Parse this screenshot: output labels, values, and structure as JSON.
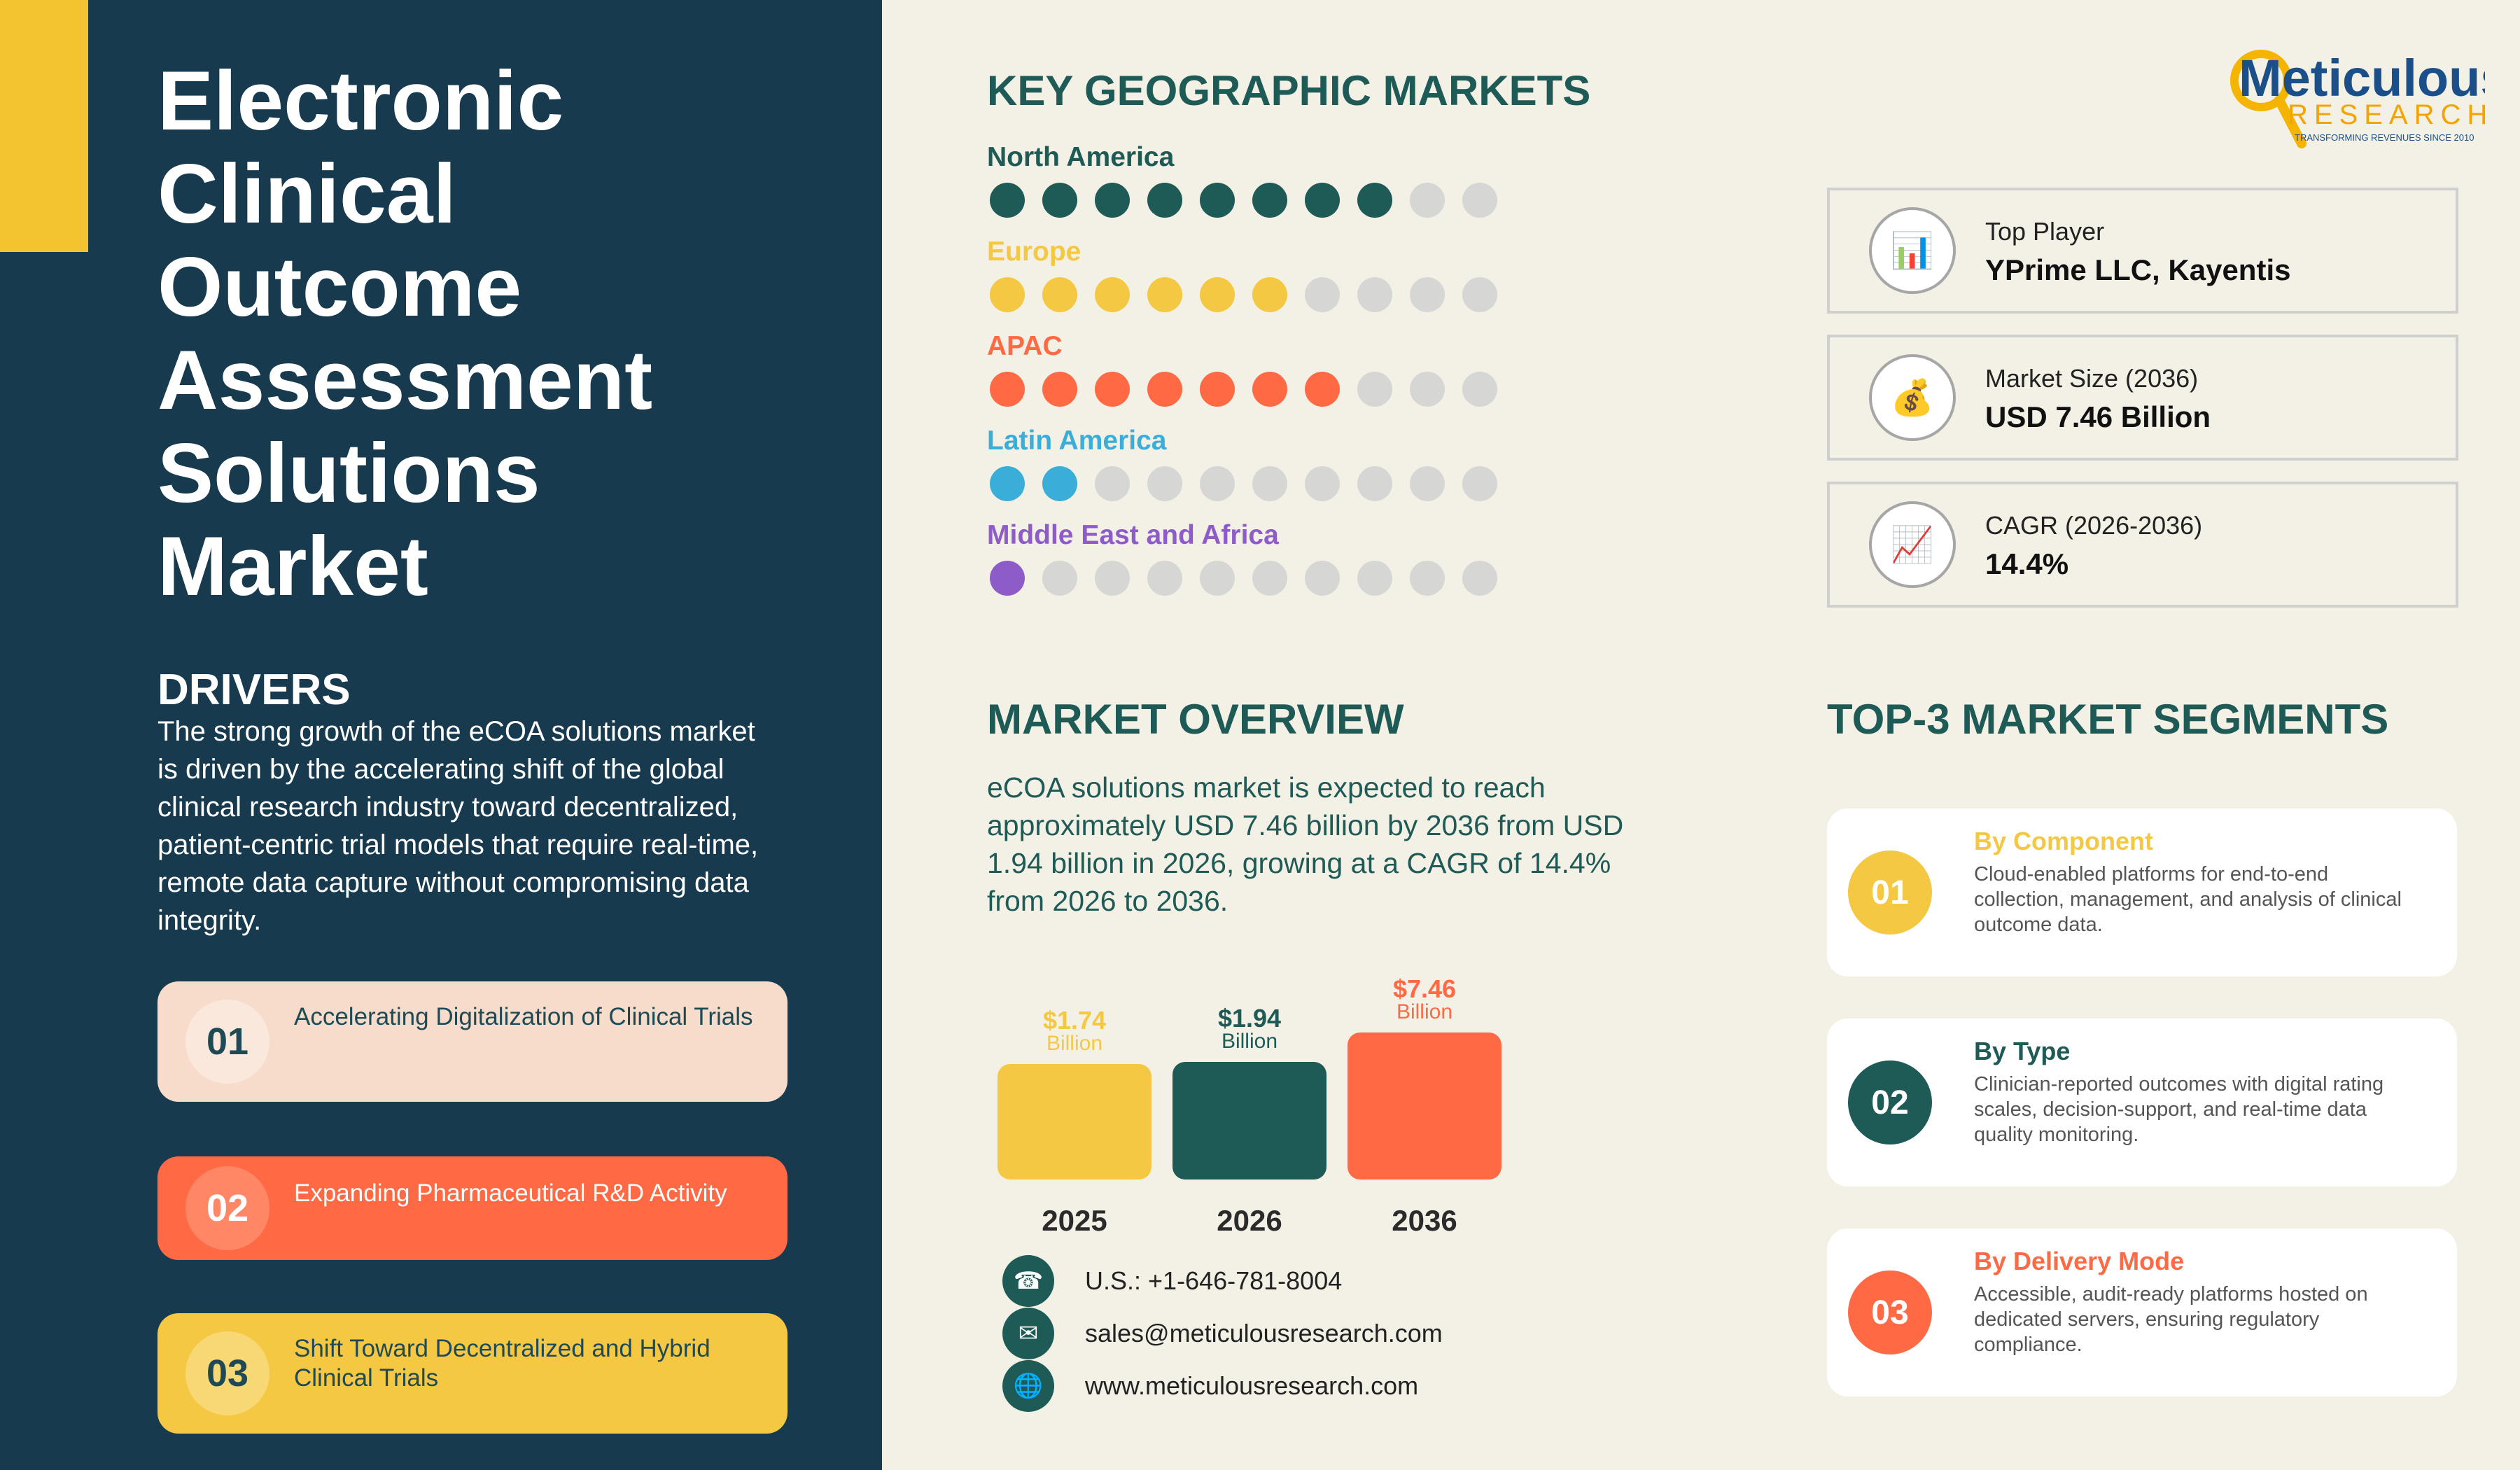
{
  "title_lines": [
    "Electronic",
    "Clinical",
    "Outcome",
    "Assessment",
    "Solutions",
    "Market"
  ],
  "drivers": {
    "heading": "DRIVERS",
    "text": "The strong growth of the eCOA solutions market is driven by the accelerating shift of the global clinical research industry toward decentralized, patient-centric trial models that require real-time, remote data capture without compromising data integrity.",
    "items": [
      {
        "num": "01",
        "label": "Accelerating Digitalization of Clinical Trials"
      },
      {
        "num": "02",
        "label": "Expanding Pharmaceutical R&D Activity"
      },
      {
        "num": "03",
        "label": "Shift Toward Decentralized and Hybrid Clinical Trials"
      }
    ]
  },
  "geo": {
    "heading": "KEY GEOGRAPHIC MARKETS",
    "regions": [
      {
        "name": "North America",
        "filled": 8,
        "total": 10,
        "color": "#1e5a56"
      },
      {
        "name": "Europe",
        "filled": 6,
        "total": 10,
        "color": "#f4c843"
      },
      {
        "name": "APAC",
        "filled": 7,
        "total": 10,
        "color": "#ff6a45"
      },
      {
        "name": "Latin America",
        "filled": 2,
        "total": 10,
        "color": "#3aaed8"
      },
      {
        "name": "Middle East and Africa",
        "filled": 1,
        "total": 10,
        "color": "#8e5cc9"
      }
    ]
  },
  "overview": {
    "heading": "MARKET OVERVIEW",
    "text": "eCOA solutions market is expected to reach approximately USD 7.46 billion by 2036 from USD 1.94 billion in 2026, growing at a CAGR of 14.4% from 2026 to 2036."
  },
  "chart_data": {
    "type": "bar",
    "categories": [
      "2025",
      "2026",
      "2036"
    ],
    "values": [
      1.74,
      1.94,
      7.46
    ],
    "value_labels": [
      "$1.74",
      "$1.94",
      "$7.46"
    ],
    "unit_label": "Billion",
    "colors": [
      "#f4c843",
      "#1e5a56",
      "#ff6a45"
    ],
    "label_colors": [
      "#f4c843",
      "#1e5a56",
      "#ff6a45"
    ]
  },
  "contacts": [
    {
      "icon": "phone-icon",
      "glyph": "☎",
      "text": "U.S.: +1-646-781-8004"
    },
    {
      "icon": "email-icon",
      "glyph": "✉",
      "text": "sales@meticulousresearch.com"
    },
    {
      "icon": "globe-icon",
      "glyph": "🌐",
      "text": "www.meticulousresearch.com"
    }
  ],
  "stats": [
    {
      "icon": "bar-chart-icon",
      "glyph": "📊",
      "label": "Top Player",
      "value": "YPrime LLC, Kayentis"
    },
    {
      "icon": "money-bag-icon",
      "glyph": "💰",
      "label": "Market Size (2036)",
      "value": "USD 7.46 Billion"
    },
    {
      "icon": "trend-chart-icon",
      "glyph": "📈",
      "label": "CAGR (2026-2036)",
      "value": "14.4%"
    }
  ],
  "segments": {
    "heading": "TOP-3 MARKET SEGMENTS",
    "items": [
      {
        "num": "01",
        "title": "By Component",
        "desc": "Cloud-enabled platforms for end-to-end collection, management, and analysis of clinical outcome data.",
        "color": "#f4c843"
      },
      {
        "num": "02",
        "title": "By Type",
        "desc": "Clinician-reported outcomes with digital rating scales, decision-support, and real-time data quality monitoring.",
        "color": "#1e5a56"
      },
      {
        "num": "03",
        "title": "By Delivery Mode",
        "desc": "Accessible, audit-ready platforms hosted on dedicated servers, ensuring regulatory compliance.",
        "color": "#ff6a45"
      }
    ]
  },
  "logo": {
    "name": "Meticulous",
    "sub": "RESEARCH",
    "tagline": "TRANSFORMING REVENUES SINCE 2010"
  }
}
